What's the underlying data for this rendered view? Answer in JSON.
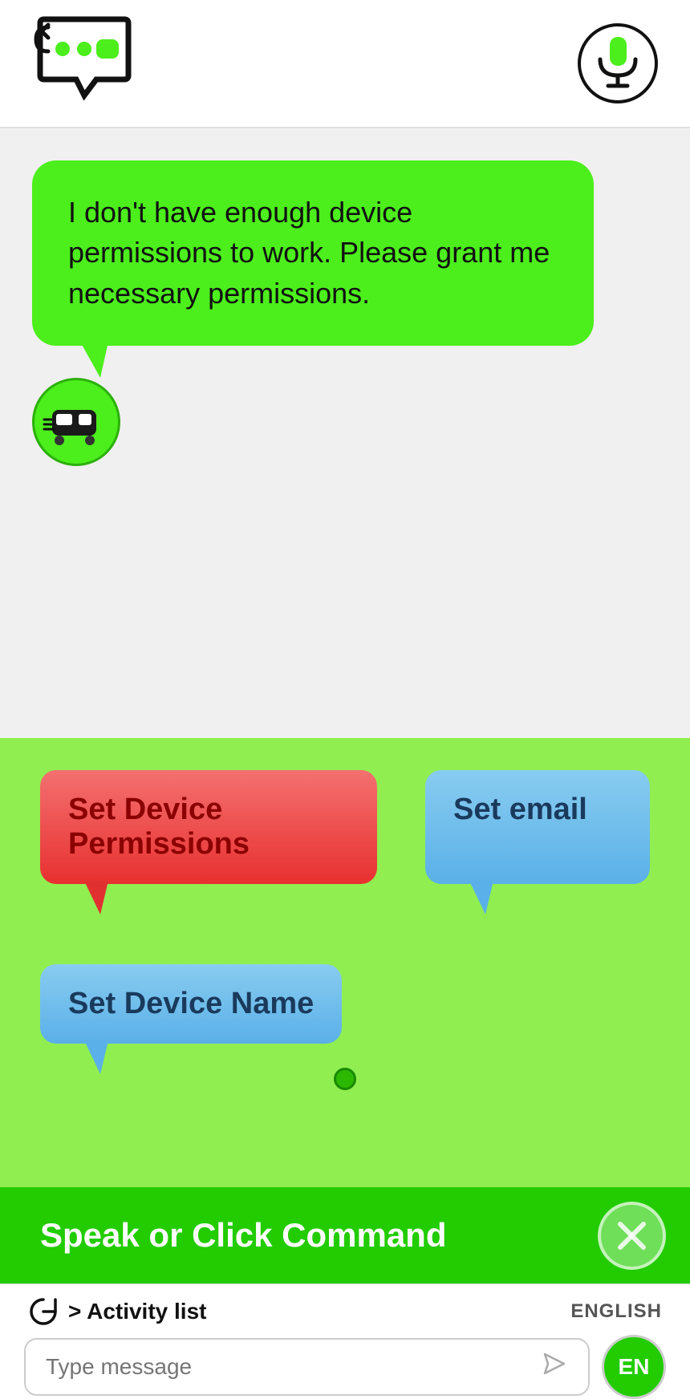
{
  "header": {
    "logo_alt": "chat-logo",
    "mic_alt": "microphone"
  },
  "chat": {
    "message": "I don't have enough device permissions to work. Please grant me necessary permissions.",
    "bot_avatar_alt": "bot-avatar"
  },
  "commands": {
    "items": [
      {
        "id": "set-device-permissions",
        "label": "Set Device Permissions",
        "style": "red"
      },
      {
        "id": "set-email",
        "label": "Set email",
        "style": "blue"
      },
      {
        "id": "set-device-name",
        "label": "Set Device Name",
        "style": "blue2"
      }
    ],
    "page_indicator": "●"
  },
  "speak_bar": {
    "label": "Speak or Click Command",
    "close_icon": "✕"
  },
  "bottom": {
    "activity_icon": "↺",
    "activity_label": "> Activity list",
    "language_label": "ENGLISH",
    "input_placeholder": "Type message",
    "en_badge": "EN",
    "send_icon": "▷"
  }
}
